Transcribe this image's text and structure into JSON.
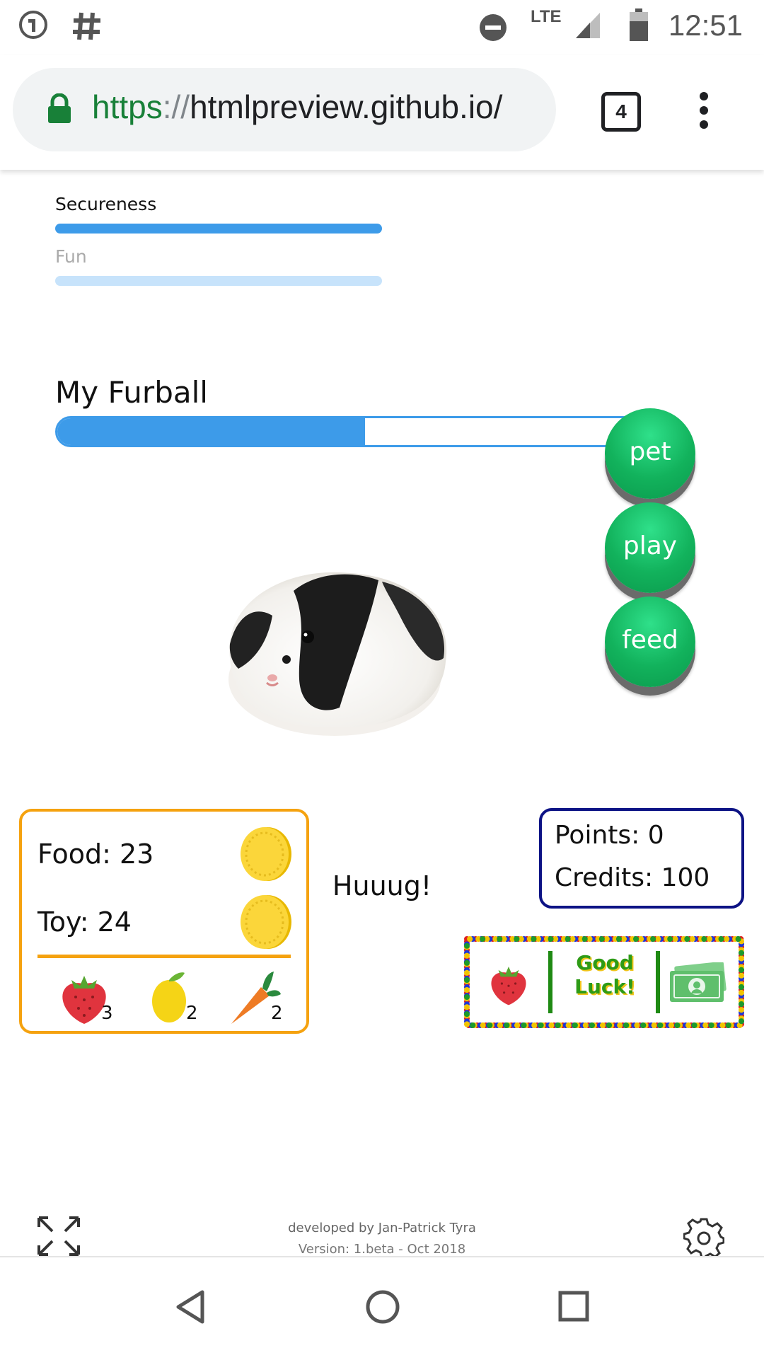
{
  "status_bar": {
    "time": "12:51",
    "network": "LTE",
    "icons": [
      "app-notification-icon",
      "hash-icon",
      "do-not-disturb-icon",
      "signal-icon",
      "battery-icon"
    ]
  },
  "browser": {
    "url_scheme": "https",
    "url_sep": "://",
    "url_host": "htmlpreview.github.io/",
    "tab_count": "4"
  },
  "stats": {
    "secureness_label": "Secureness",
    "secureness_level": 1.0,
    "fun_label": "Fun",
    "fun_level": 1.0
  },
  "pet": {
    "name": "My Furball",
    "progress": 0.53,
    "message": "Huuug!"
  },
  "actions": {
    "pet_label": "pet",
    "play_label": "play",
    "feed_label": "feed"
  },
  "inventory": {
    "food_label": "Food: 23",
    "toy_label": "Toy: 24",
    "strawberry_count": "3",
    "lemon_count": "2",
    "carrot_count": "2"
  },
  "score": {
    "points_label": "Points: 0",
    "credits_label": "Credits: 100"
  },
  "luck": {
    "line1": "Good",
    "line2": "Luck!"
  },
  "footer": {
    "developed_by": "developed by Jan-Patrick Tyra",
    "version": "Version: 1.beta - Oct 2018"
  },
  "colors": {
    "accent_blue": "#3d9be9",
    "button_green": "#12b25c",
    "inventory_border": "#f5a20f",
    "points_border": "#0d1385"
  }
}
